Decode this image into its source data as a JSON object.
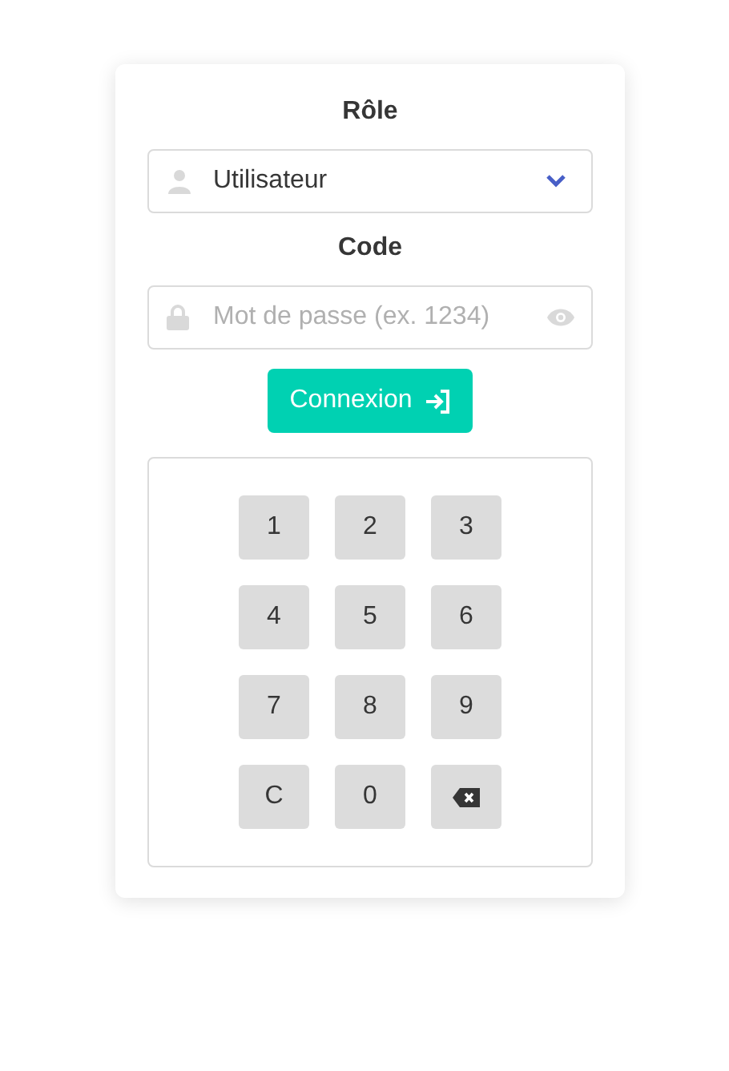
{
  "role": {
    "label": "Rôle",
    "value": "Utilisateur"
  },
  "code": {
    "label": "Code",
    "placeholder": "Mot de passe (ex. 1234)"
  },
  "login_button": {
    "label": "Connexion"
  },
  "keypad": [
    {
      "kind": "key",
      "label": "1"
    },
    {
      "kind": "key",
      "label": "2"
    },
    {
      "kind": "key",
      "label": "3"
    },
    {
      "kind": "key",
      "label": "4"
    },
    {
      "kind": "key",
      "label": "5"
    },
    {
      "kind": "key",
      "label": "6"
    },
    {
      "kind": "key",
      "label": "7"
    },
    {
      "kind": "key",
      "label": "8"
    },
    {
      "kind": "key",
      "label": "9"
    },
    {
      "kind": "key",
      "label": "C"
    },
    {
      "kind": "key",
      "label": "0"
    },
    {
      "kind": "backspace"
    }
  ]
}
